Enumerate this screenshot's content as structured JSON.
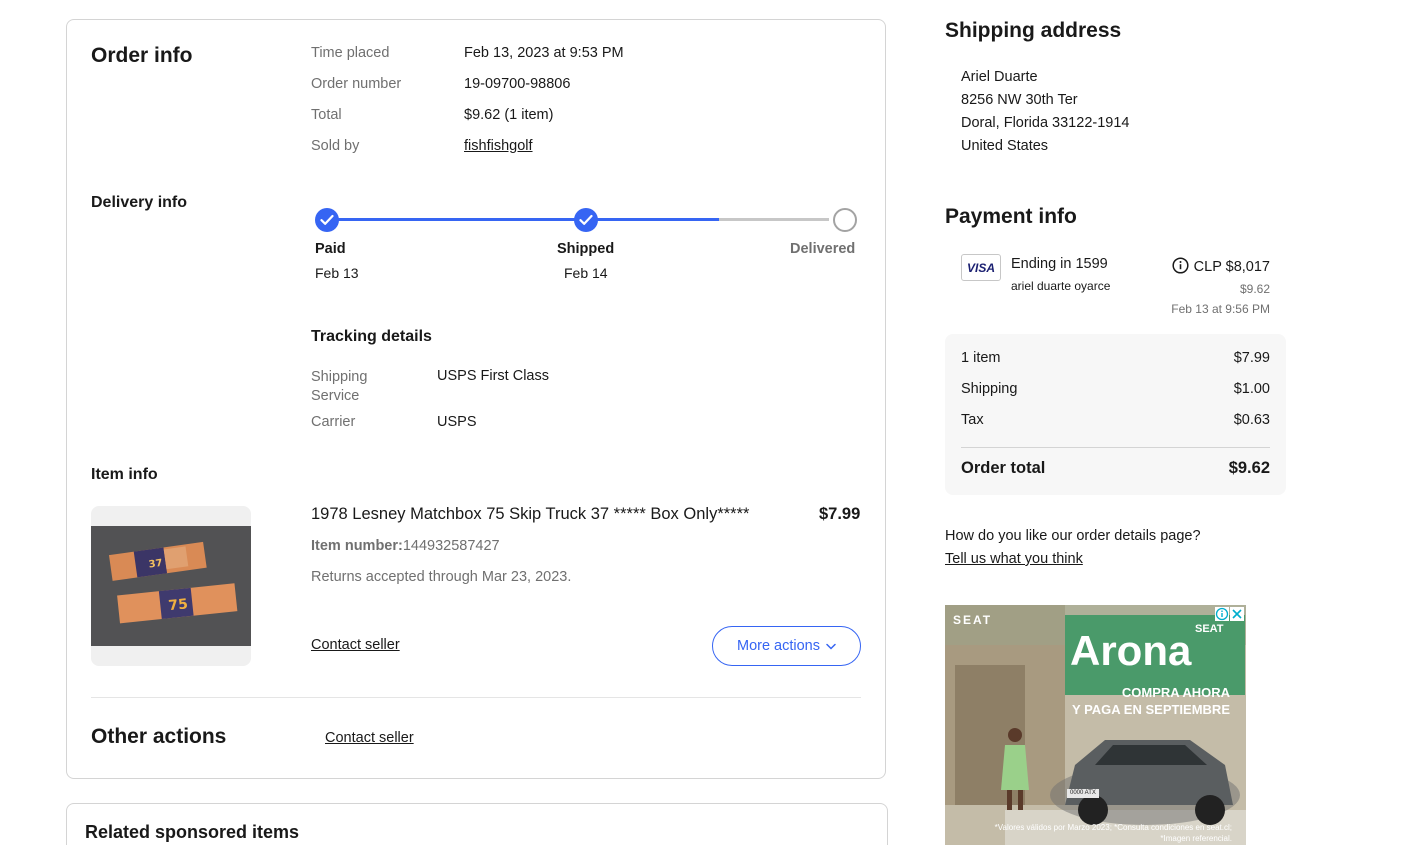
{
  "order_info": {
    "heading": "Order info",
    "time_placed_label": "Time placed",
    "time_placed_value": "Feb 13, 2023 at 9:53 PM",
    "order_number_label": "Order number",
    "order_number_value": "19-09700-98806",
    "total_label": "Total",
    "total_value": "$9.62 (1 item)",
    "sold_by_label": "Sold by",
    "sold_by_value": "fishfishgolf"
  },
  "delivery_info": {
    "heading": "Delivery info",
    "progress_fraction": 0.78,
    "steps": [
      {
        "name": "Paid",
        "date": "Feb 13",
        "done": true
      },
      {
        "name": "Shipped",
        "date": "Feb 14",
        "done": true
      },
      {
        "name": "Delivered",
        "date": "",
        "done": false
      }
    ]
  },
  "tracking": {
    "heading": "Tracking details",
    "service_label": "Shipping\nService",
    "service_value": "USPS First Class",
    "carrier_label": "Carrier",
    "carrier_value": "USPS"
  },
  "item_info": {
    "heading": "Item info",
    "title": "1978 Lesney Matchbox 75  Skip Truck 37 ***** Box Only*****",
    "price": "$7.99",
    "item_number_label": "Item number:",
    "item_number_value": "144932587427",
    "returns": "Returns accepted through Mar 23, 2023.",
    "contact_seller": "Contact seller",
    "more_actions": "More actions"
  },
  "other_actions": {
    "heading": "Other actions",
    "contact_seller": "Contact seller"
  },
  "related": {
    "heading": "Related sponsored items"
  },
  "shipping_address": {
    "heading": "Shipping address",
    "lines": [
      "Ariel Duarte",
      "8256 NW 30th Ter",
      "Doral, Florida 33122-1914",
      "United States"
    ]
  },
  "payment_info": {
    "heading": "Payment info",
    "card_brand": "VISA",
    "ending": "Ending in 1599",
    "card_holder": "ariel duarte oyarce",
    "amount_local": "CLP $8,017",
    "amount_usd": "$9.62",
    "date": "Feb 13 at 9:56 PM"
  },
  "summary": {
    "items_label": "1 item",
    "items_value": "$7.99",
    "shipping_label": "Shipping",
    "shipping_value": "$1.00",
    "tax_label": "Tax",
    "tax_value": "$0.63",
    "total_label": "Order total",
    "total_value": "$9.62"
  },
  "feedback": {
    "question": "How do you like our order details page?",
    "link": "Tell us what you think"
  },
  "ad": {
    "brand": "SEAT",
    "model_brand": "SEAT",
    "model": "Arona",
    "line1": "COMPRA AHORA",
    "line2": "Y PAGA EN SEPTIEMBRE",
    "plate": "0000 ATX",
    "fine_print1": "*Valores válidos por Marzo 2023; *Consulta condiciones en seat.cl;",
    "fine_print2": "*Imagen referencial."
  },
  "colors": {
    "accent": "#3665f3",
    "text": "#191919",
    "muted": "#707070",
    "border": "#d4d4d4"
  }
}
